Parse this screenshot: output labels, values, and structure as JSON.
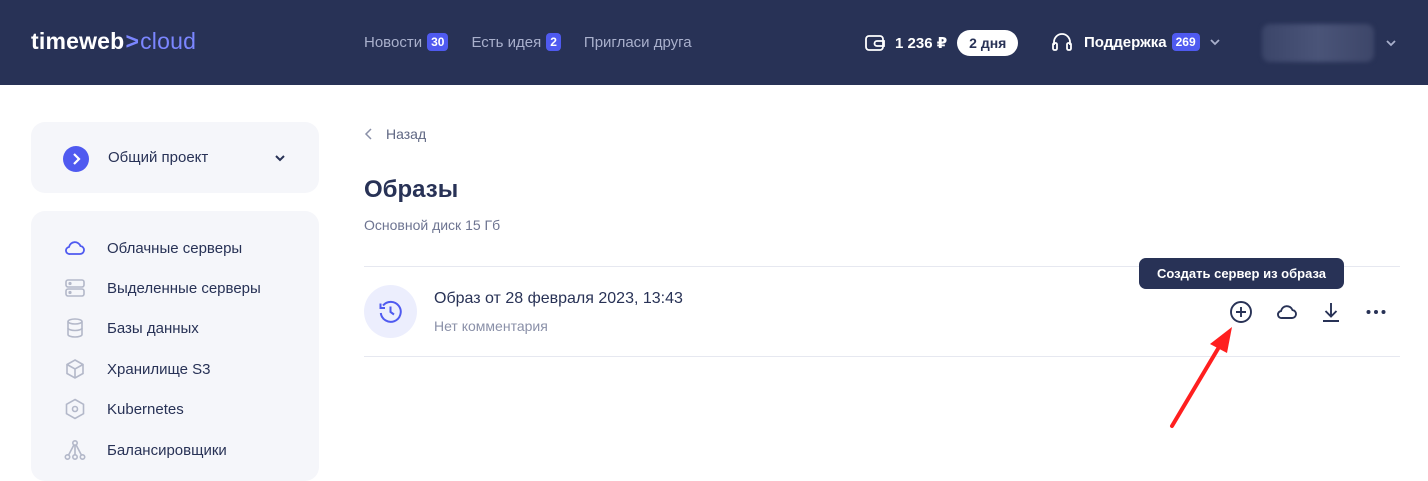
{
  "header": {
    "logo_main": "timeweb",
    "logo_sep": ">",
    "logo_cloud": "cloud",
    "nav": [
      {
        "label": "Новости",
        "badge": "30"
      },
      {
        "label": "Есть идея",
        "badge": "2"
      },
      {
        "label": "Пригласи друга",
        "badge": ""
      }
    ],
    "balance": "1 236 ₽",
    "days": "2 дня",
    "support_label": "Поддержка",
    "support_badge": "269"
  },
  "sidebar": {
    "project": "Общий проект",
    "items": [
      {
        "label": "Облачные серверы",
        "icon": "cloud-icon",
        "active": true
      },
      {
        "label": "Выделенные серверы",
        "icon": "server-icon"
      },
      {
        "label": "Базы данных",
        "icon": "database-icon"
      },
      {
        "label": "Хранилище S3",
        "icon": "cube-icon"
      },
      {
        "label": "Kubernetes",
        "icon": "kubernetes-icon"
      },
      {
        "label": "Балансировщики",
        "icon": "balancer-icon"
      }
    ]
  },
  "main": {
    "back": "Назад",
    "title": "Образы",
    "subtitle": "Основной диск 15 Гб",
    "image": {
      "title": "Образ от 28 февраля 2023, 13:43",
      "comment": "Нет комментария"
    },
    "tooltip": "Создать сервер из образа",
    "actions": [
      "add-circle-icon",
      "cloud-icon",
      "download-icon",
      "more-icon"
    ]
  },
  "colors": {
    "header_bg": "#283256",
    "accent": "#4f5af0",
    "annotation_arrow": "#ff1f1f"
  }
}
